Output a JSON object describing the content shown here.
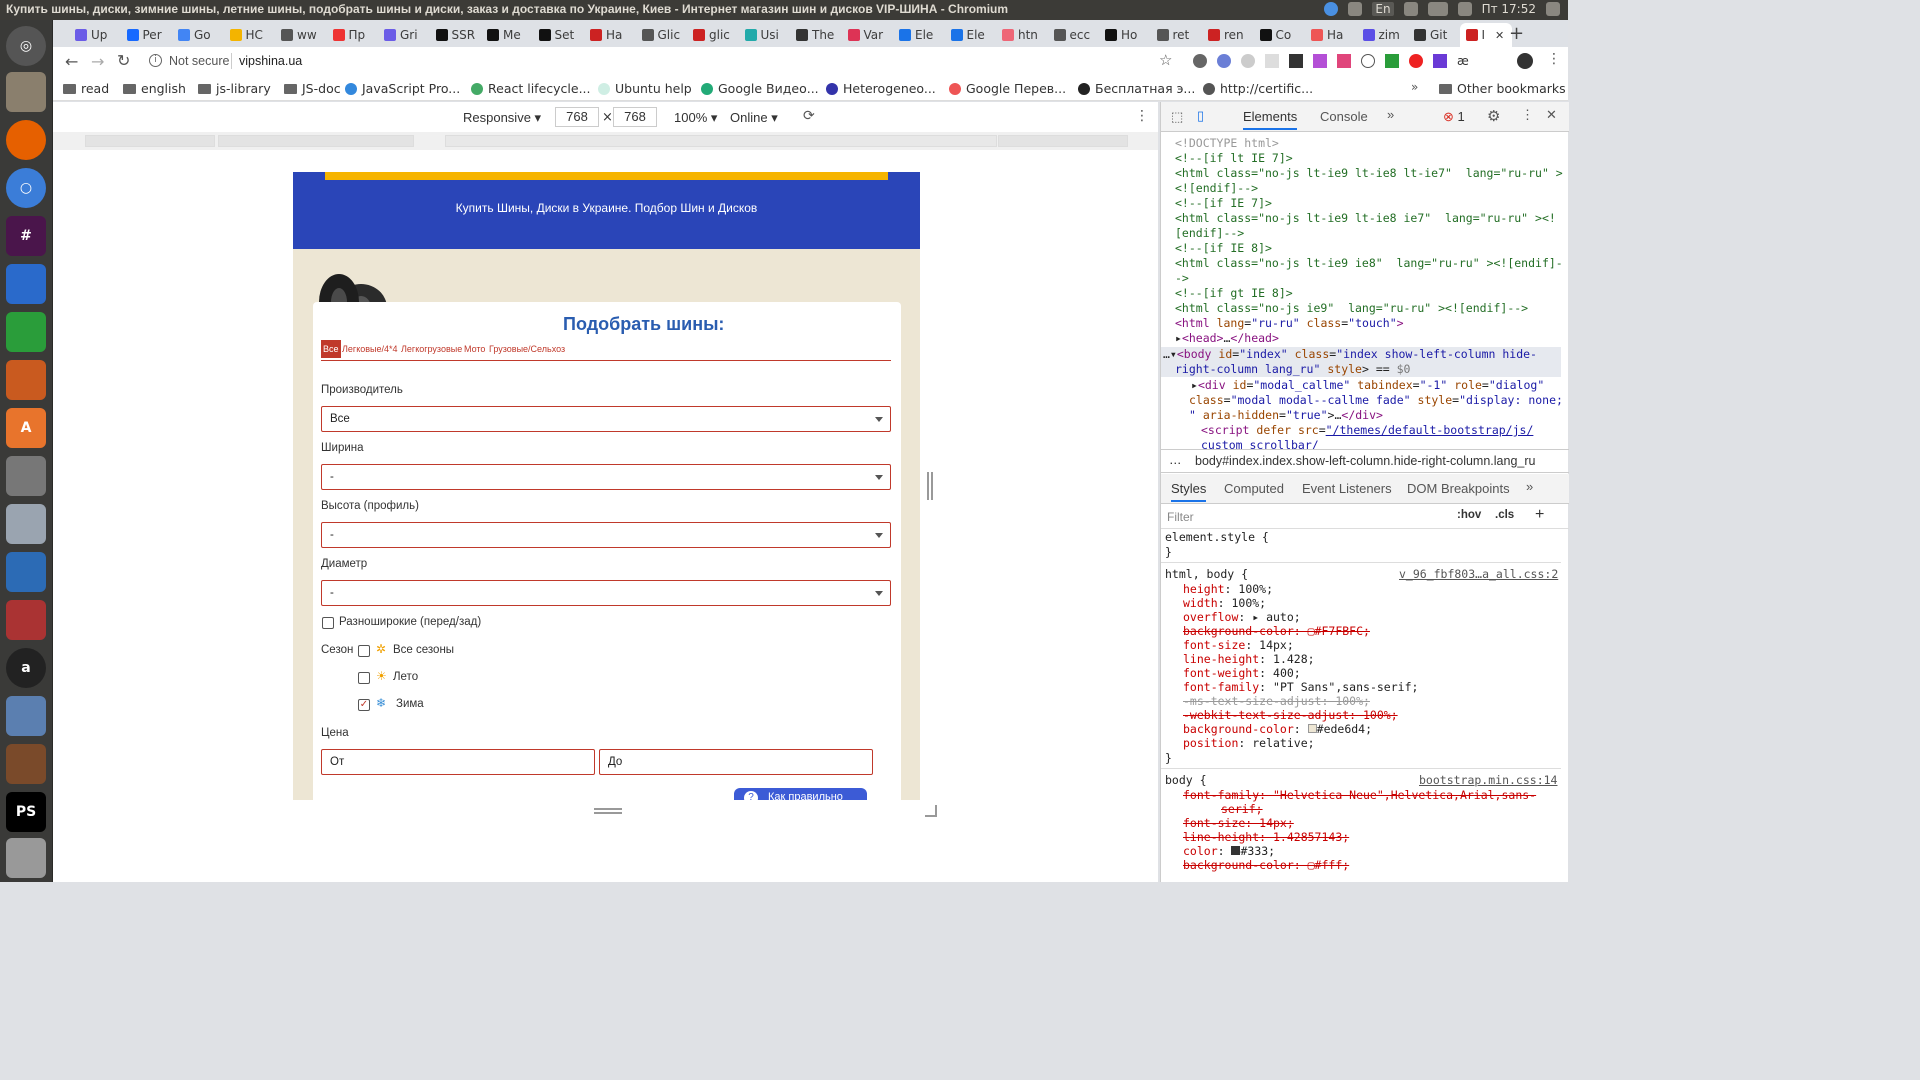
{
  "os": {
    "window_title": "Купить шины, диски, зимние шины, летние шины, подобрать шины и диски, заказ и доставка по Украине, Киев - Интернет магазин шин и дисков VIP-ШИНА - Chromium",
    "clock": "Пт 17:52",
    "keyboard_layout": "En"
  },
  "browser": {
    "tabs": [
      "Up",
      "Per",
      "Go",
      "HC",
      "ww",
      "Пр",
      "Gri",
      "SSR",
      "Me",
      "Set",
      "Ha",
      "Glic",
      "glic",
      "Usi",
      "The",
      "Var",
      "Ele",
      "Ele",
      "htn",
      "ecc",
      "Ho",
      "ret",
      "ren",
      "Co",
      "Ha",
      "zim",
      "Git",
      "I"
    ],
    "url_security": "Not secure",
    "url": "vipshina.ua",
    "bookmarks": [
      "read",
      "english",
      "js-library",
      "JS-doc",
      "JavaScript Pro...",
      "React lifecycle...",
      "Ubuntu help",
      "Google Видео...",
      "Heterogeneo...",
      "Google Перев...",
      "Бесплатная э...",
      "http://certific..."
    ],
    "other_bookmarks": "Other bookmarks"
  },
  "device_toolbar": {
    "mode": "Responsive",
    "width": "768",
    "height": "768",
    "zoom": "100%",
    "network": "Online"
  },
  "page": {
    "tagline": "Купить Шины, Диски в Украине. Подбор Шин и Дисков",
    "heading": "Подобрать шины:",
    "categories": [
      "Все",
      "Легковые/4*4",
      "Легкогрузовые",
      "Мото",
      "Грузовые/Сельхоз"
    ],
    "fields": {
      "manufacturer_label": "Производитель",
      "manufacturer_value": "Все",
      "width_label": "Ширина",
      "width_value": "-",
      "height_label": "Высота (профиль)",
      "height_value": "-",
      "diameter_label": "Диаметр",
      "diameter_value": "-"
    },
    "staggered_label": "Разноширокие (перед/зад)",
    "season_label": "Сезон",
    "seasons": [
      {
        "label": "Все сезоны",
        "checked": false
      },
      {
        "label": "Лето",
        "checked": false
      },
      {
        "label": "Зима",
        "checked": true
      }
    ],
    "price_label": "Цена",
    "price_from_placeholder": "От",
    "price_to_placeholder": "До",
    "help_button": "Как правильно"
  },
  "devtools": {
    "tabs": [
      "Elements",
      "Console"
    ],
    "error_count": "1",
    "breadcrumb": "body#index.index.show-left-column.hide-right-column.lang_ru",
    "sub_tabs": [
      "Styles",
      "Computed",
      "Event Listeners",
      "DOM Breakpoints"
    ],
    "filter_placeholder": "Filter",
    "hov": ":hov",
    "cls": ".cls",
    "rule_source_1": "v_96_fbf803…a_all.css:2",
    "rule_source_2": "bootstrap.min.css:14",
    "colors": {
      "html_bg": "#ede6d4",
      "header_blue": "#2a45b8",
      "accent_red": "#c0392b",
      "heading_blue": "#2a5db0"
    }
  }
}
